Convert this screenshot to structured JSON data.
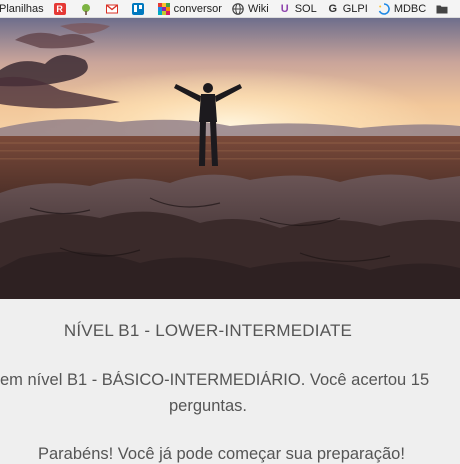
{
  "bookmarks": [
    {
      "label": "Planilhas",
      "icon": "spreadsheet-icon"
    },
    {
      "label": "",
      "icon": "r-logo-icon",
      "color": "#e53935"
    },
    {
      "label": "",
      "icon": "tree-logo-icon",
      "color": "#7cb342"
    },
    {
      "label": "",
      "icon": "gmail-icon",
      "color": "#d93025"
    },
    {
      "label": "",
      "icon": "trello-icon",
      "color": "#0079bf"
    },
    {
      "label": "conversor",
      "icon": "color-grid-icon"
    },
    {
      "label": "Wiki",
      "icon": "globe-icon"
    },
    {
      "label": "SOL",
      "icon": "sol-logo-icon",
      "color": "#8e44ad"
    },
    {
      "label": "GLPI",
      "icon": "glpi-logo-icon"
    },
    {
      "label": "MDBC",
      "icon": "spinner-icon"
    },
    {
      "label": "",
      "icon": "folder-icon"
    }
  ],
  "result": {
    "level_title": "NÍVEL B1 - LOWER-INTERMEDIATE",
    "message_line1": "em nível B1 - BÁSICO-INTERMEDIÁRIO. Você acertou 15",
    "message_line2": "perguntas.",
    "congrats": "Parabéns! Você já pode começar sua preparação!"
  },
  "colors": {
    "background": "#efefef",
    "text": "#555555"
  }
}
